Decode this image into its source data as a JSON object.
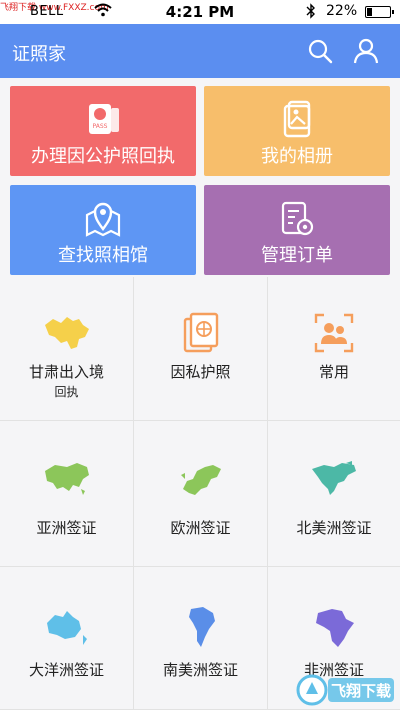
{
  "status_bar": {
    "watermark": "飞翔下载 www.FXXZ.com",
    "carrier": "BELL",
    "signal_dots": "●●●○○",
    "time": "4:21 PM",
    "battery_pct": "22%",
    "battery_level": 0.22
  },
  "header": {
    "title": "证照家",
    "search_icon": "search-icon",
    "user_icon": "user-icon",
    "color": "#5b8ef0"
  },
  "tiles": [
    {
      "label": "办理因公护照回执",
      "icon": "passport-icon",
      "color": "#f26a6b"
    },
    {
      "label": "我的相册",
      "icon": "photo-album-icon",
      "color": "#f7be6b"
    },
    {
      "label": "查找照相馆",
      "icon": "map-pin-icon",
      "color": "#5e96f4"
    },
    {
      "label": "管理订单",
      "icon": "order-settings-icon",
      "color": "#a66fb1"
    }
  ],
  "grid": [
    {
      "label": "甘肃出入境",
      "sub": "回执",
      "icon": "gansu-map-icon",
      "color": "#f5d04a"
    },
    {
      "label": "因私护照",
      "sub": "",
      "icon": "private-passport-icon",
      "color": "#f59e5c"
    },
    {
      "label": "常用",
      "sub": "",
      "icon": "common-people-icon",
      "color": "#f59e5c"
    },
    {
      "label": "亚洲签证",
      "sub": "",
      "icon": "asia-map-icon",
      "color": "#8cc65a"
    },
    {
      "label": "欧洲签证",
      "sub": "",
      "icon": "europe-map-icon",
      "color": "#8cc65a"
    },
    {
      "label": "北美洲签证",
      "sub": "",
      "icon": "north-america-map-icon",
      "color": "#4cb8a6"
    },
    {
      "label": "大洋洲签证",
      "sub": "",
      "icon": "oceania-map-icon",
      "color": "#5fbfe8"
    },
    {
      "label": "南美洲签证",
      "sub": "",
      "icon": "south-america-map-icon",
      "color": "#5a8ee8"
    },
    {
      "label": "非洲签证",
      "sub": "",
      "icon": "africa-map-icon",
      "color": "#7b6ad8"
    }
  ],
  "corner_logo": {
    "text": "飞翔下载",
    "icon": "fxxz-logo"
  }
}
